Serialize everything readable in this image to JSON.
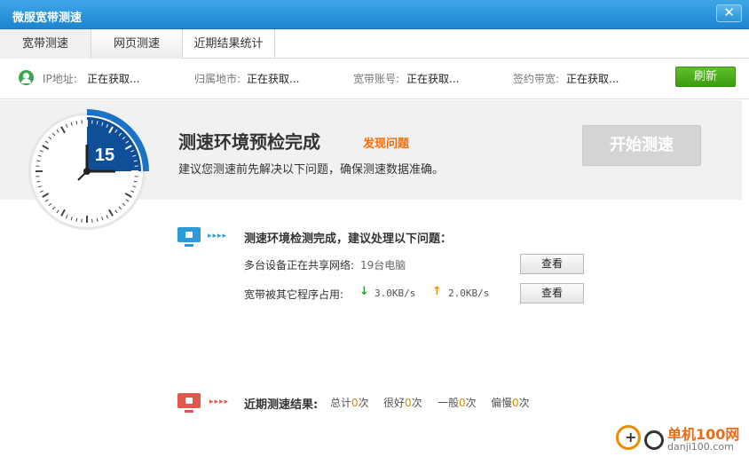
{
  "window": {
    "title": "微服宽带测速",
    "close_glyph": "✕"
  },
  "tabs": [
    {
      "label": "宽带测速",
      "active": true
    },
    {
      "label": "网页测速",
      "active": false
    },
    {
      "label": "近期结果统计",
      "active": false
    }
  ],
  "info": {
    "ip_label": "IP地址:",
    "ip_value": "正在获取...",
    "location_label": "归属地市:",
    "location_value": "正在获取...",
    "account_label": "宽带账号:",
    "account_value": "正在获取...",
    "bandwidth_label": "签约带宽:",
    "bandwidth_value": "正在获取...",
    "refresh_label": "刷新"
  },
  "precheck": {
    "gauge_number": "15",
    "title": "测速环境预检完成",
    "issue_link": "发现问题",
    "advice": "建议您测速前先解决以下问题，确保测速数据准确。",
    "start_button": "开始测速"
  },
  "detection": {
    "arrows": "▸▸▸▸",
    "title": "测速环境检测完成，建议处理以下问题：",
    "rows": [
      {
        "label": "多台设备正在共享网络:",
        "value": "19台电脑",
        "button": "查看"
      },
      {
        "label": "宽带被其它程序占用:",
        "down_value": "3.0KB/s",
        "up_value": "2.0KB/s",
        "button": "查看"
      }
    ]
  },
  "recent": {
    "arrows": "▸▸▸▸",
    "title": "近期测速结果:",
    "stats": [
      {
        "label": "总计",
        "count": "0",
        "unit": "次"
      },
      {
        "label": "很好",
        "count": "0",
        "unit": "次"
      },
      {
        "label": "一般",
        "count": "0",
        "unit": "次"
      },
      {
        "label": "偏慢",
        "count": "0",
        "unit": "次"
      }
    ]
  },
  "watermark": {
    "name": "单机100网",
    "url": "danji100.com"
  },
  "colors": {
    "titlebar": "#2b95dc",
    "accent_blue": "#1a6fc0",
    "refresh_green": "#48ab1c",
    "issue_orange": "#ff6a00",
    "monitor_blue": "#2a9bd8",
    "monitor_red": "#e2574c"
  }
}
